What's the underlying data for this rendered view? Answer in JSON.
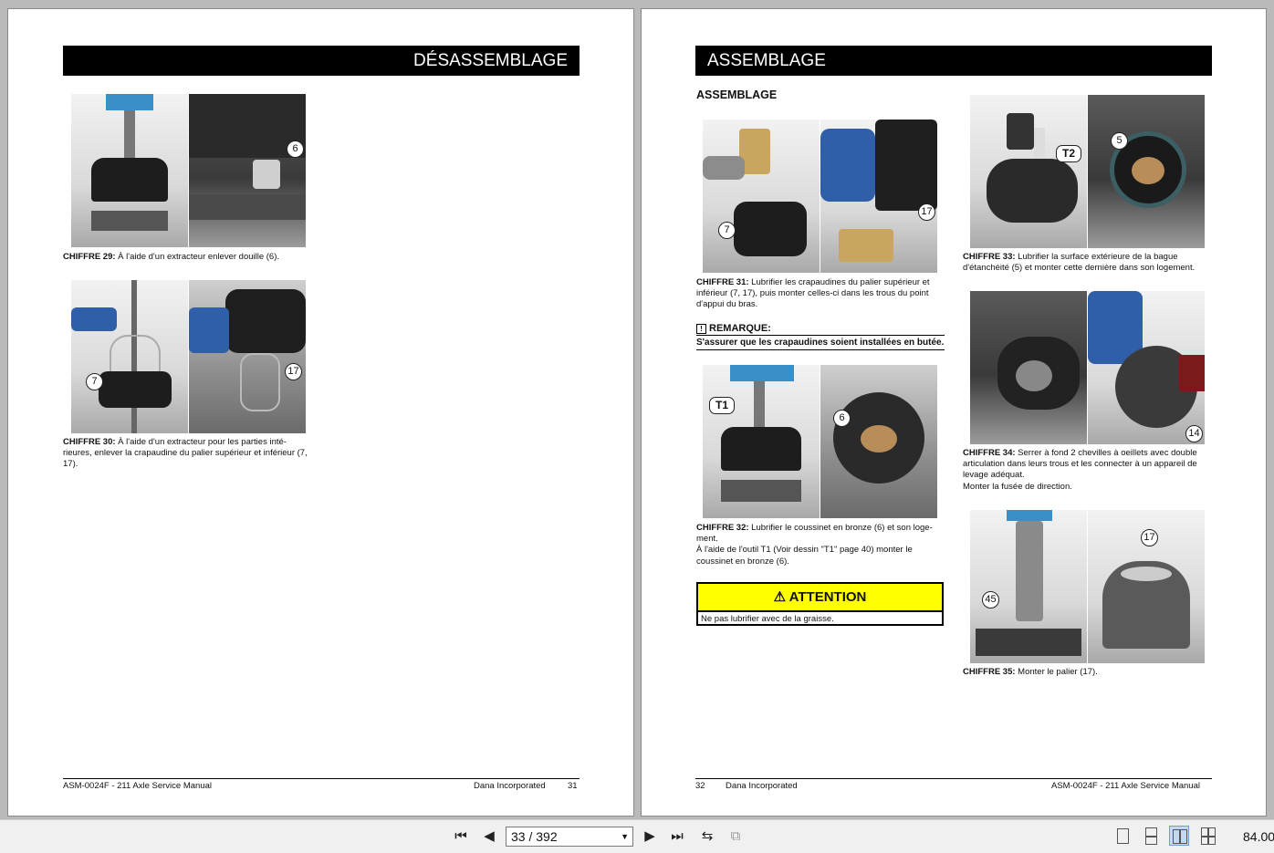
{
  "viewer": {
    "page_indicator": "33 / 392",
    "zoom": "84.00",
    "icons": [
      "first-page-icon",
      "prev-page-icon",
      "next-page-icon",
      "last-page-icon",
      "rotate-icon",
      "fit-icon",
      "single-page-view-icon",
      "continuous-view-icon",
      "two-page-view-icon",
      "two-page-continuous-view-icon"
    ]
  },
  "left_page": {
    "banner": "DÉSASSEMBLAGE",
    "fig29": {
      "label": "CHIFFRE 29:",
      "text": " À l'aide d'un extracteur enlever douille (6).",
      "callouts": [
        "6"
      ]
    },
    "fig30": {
      "label": "CHIFFRE 30:",
      "text": " À l'aide d'un extracteur pour les parties inté-rieures, enlever la crapaudine du palier supérieur et inférieur (7, 17).",
      "callouts": [
        "7",
        "17"
      ]
    },
    "footer_left": "ASM-0024F - 211 Axle Service Manual",
    "footer_company": "Dana Incorporated",
    "footer_page": "31"
  },
  "right_page": {
    "banner": "ASSEMBLAGE",
    "section_title": "ASSEMBLAGE",
    "fig31": {
      "label": "CHIFFRE 31:",
      "text": " Lubrifier les crapaudines du palier supérieur et inférieur (7, 17), puis monter celles-ci dans les trous du point d'appui du bras.",
      "callouts": [
        "7",
        "17"
      ]
    },
    "remarque_title": "REMARQUE:",
    "remarque_text": "S'assurer que les crapaudines soient installées en butée.",
    "fig32": {
      "label": "CHIFFRE 32:",
      "text": " Lubrifier le coussinet en bronze (6) et son loge-ment.",
      "text2": "À l'aide de l'outil T1 (Voir dessin \"T1\" page 40) monter le coussinet en bronze (6).",
      "callouts": [
        "T1",
        "6"
      ]
    },
    "attention_title": "ATTENTION",
    "attention_text": "Ne pas lubrifier avec de la graisse.",
    "fig33": {
      "label": "CHIFFRE 33:",
      "text": " Lubrifier la surface extérieure de la bague d'étanchéité (5) et monter cette dernière dans son logement.",
      "callouts": [
        "T2",
        "5"
      ]
    },
    "fig34": {
      "label": "CHIFFRE 34:",
      "text": " Serrer à fond 2 chevilles à oeillets avec double articulation dans leurs trous et les connecter à un appareil de levage adéquat.",
      "text2": "Monter la fusée de direction.",
      "callouts": [
        "14"
      ]
    },
    "fig35": {
      "label": "CHIFFRE 35:",
      "text": " Monter le palier (17).",
      "callouts": [
        "45",
        "17"
      ]
    },
    "footer_page": "32",
    "footer_company": "Dana Incorporated",
    "footer_right": "ASM-0024F - 211 Axle Service Manual"
  }
}
